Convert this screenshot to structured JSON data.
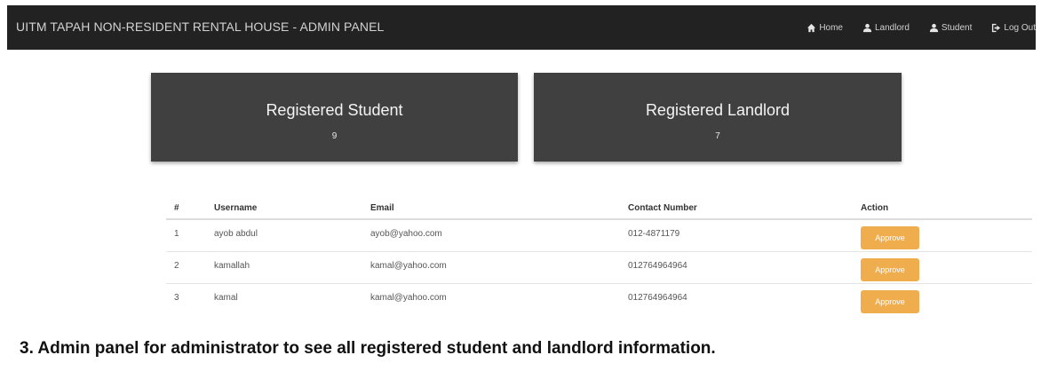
{
  "navbar": {
    "brand": "UITM TAPAH NON-RESIDENT RENTAL HOUSE - ADMIN PANEL",
    "links": [
      {
        "label": "Home",
        "icon": "home-icon"
      },
      {
        "label": "Landlord",
        "icon": "user-icon"
      },
      {
        "label": "Student",
        "icon": "user-icon"
      },
      {
        "label": "Log Out",
        "icon": "logout-icon"
      }
    ]
  },
  "cards": [
    {
      "title": "Registered Student",
      "count": "9"
    },
    {
      "title": "Registered Landlord",
      "count": "7"
    }
  ],
  "table": {
    "headers": [
      "#",
      "Username",
      "Email",
      "Contact Number",
      "Action"
    ],
    "rows": [
      {
        "num": "1",
        "username": "ayob abdul",
        "email": "ayob@yahoo.com",
        "contact": "012-4871179",
        "action": "Approve"
      },
      {
        "num": "2",
        "username": "kamallah",
        "email": "kamal@yahoo.com",
        "contact": "012764964964",
        "action": "Approve"
      },
      {
        "num": "3",
        "username": "kamal",
        "email": "kamal@yahoo.com",
        "contact": "012764964964",
        "action": "Approve"
      }
    ]
  },
  "caption": "3. Admin panel for administrator to see all registered student and landlord information.",
  "colors": {
    "navbar_bg": "#222222",
    "card_bg": "#404040",
    "approve_button": "#f0ad4e"
  }
}
